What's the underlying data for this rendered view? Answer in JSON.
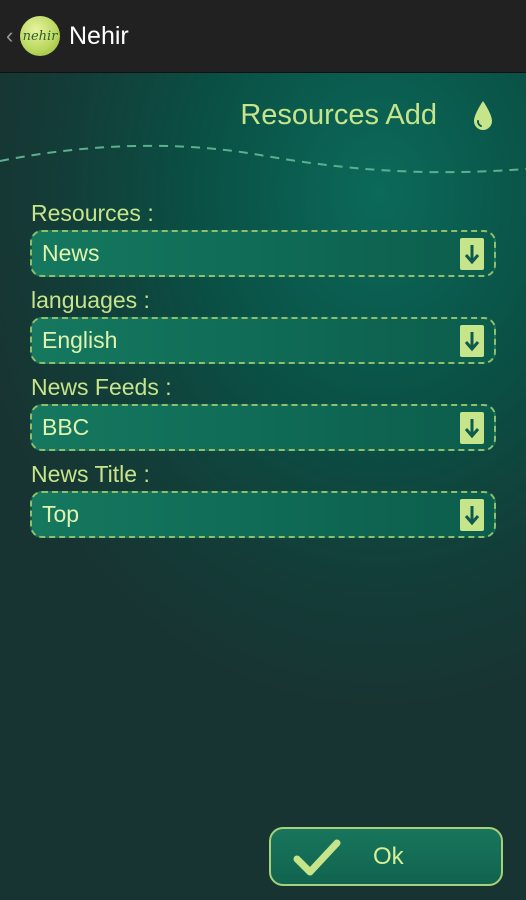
{
  "app": {
    "title": "Nehir",
    "logo_text": "nehir"
  },
  "page": {
    "title": "Resources Add"
  },
  "form": {
    "fields": [
      {
        "label": "Resources :",
        "value": "News"
      },
      {
        "label": "languages :",
        "value": "English"
      },
      {
        "label": "News Feeds :",
        "value": "BBC"
      },
      {
        "label": "News Title :",
        "value": "Top"
      }
    ]
  },
  "actions": {
    "ok_label": "Ok"
  },
  "icons": {
    "back": "chevron-left-icon",
    "logo": "nehir-logo",
    "page": "water-drop-icon",
    "select": "arrow-down-icon",
    "ok": "checkmark-icon"
  },
  "colors": {
    "accent": "#c6e48a",
    "field_border": "#8fbf6a",
    "action_bar": "#212121"
  }
}
